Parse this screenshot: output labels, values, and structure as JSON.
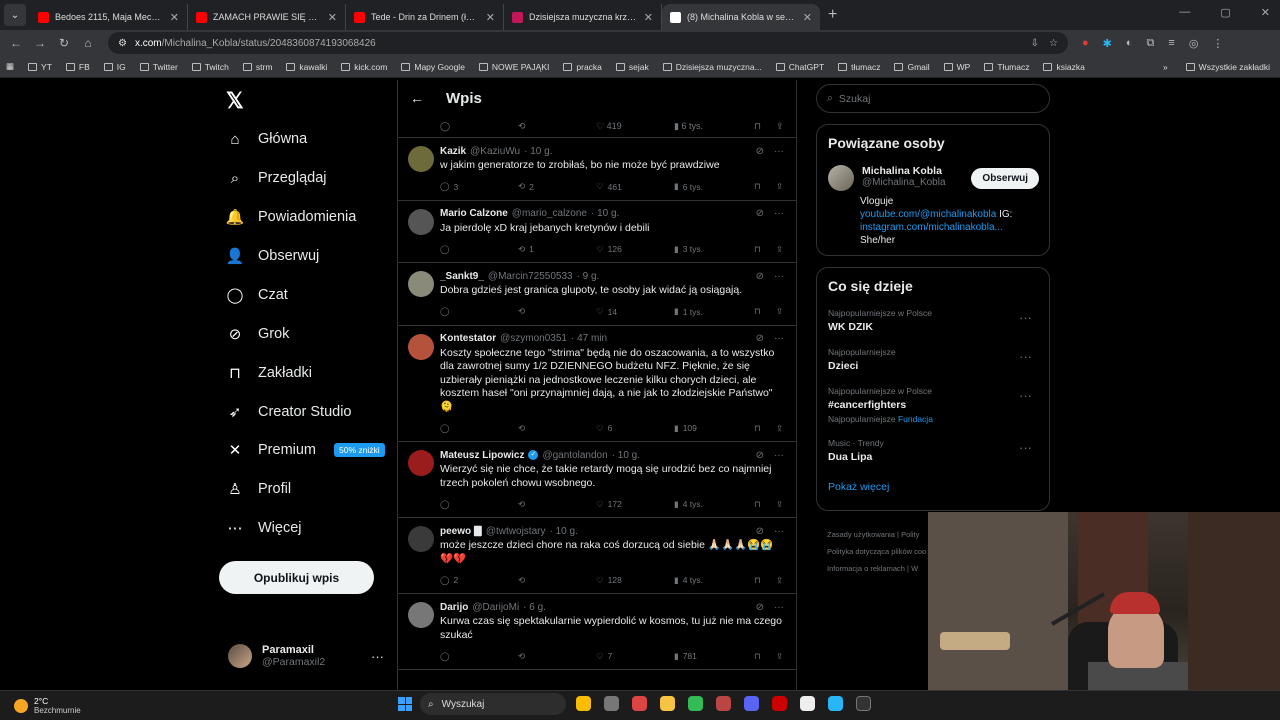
{
  "browser": {
    "tabs": [
      {
        "title": "Bedoes 2115, Maja Mecan, Cam",
        "color": "#ff0000"
      },
      {
        "title": "ZAMACH PRAWIE SIĘ UDAŁ - Yo",
        "color": "#ff0000"
      },
      {
        "title": "Tede - Drin za Drinem (łatwogo",
        "color": "#ff0000"
      },
      {
        "title": "Dzisiejsza muzyczna krzyżówka",
        "color": "#c2185b"
      },
      {
        "title": "(8) Michalina Kobla w serwisie",
        "color": "#ffffff",
        "active": true
      }
    ],
    "new_tab": "+",
    "url_host": "x.com",
    "url_path": "/Michalina_Kobla/status/2048360874193068426",
    "bookmarks": [
      "YT",
      "FB",
      "IG",
      "Twitter",
      "Twitch",
      "strm",
      "kawalki",
      "kick.com",
      "Mapy Google",
      "NOWE PAJĄKI",
      "pracka",
      "sejak",
      "Dzisiejsza muzyczna...",
      "ChatGPT",
      "tłumacz",
      "Gmail",
      "WP",
      "Tłumacz",
      "ksiazka"
    ],
    "bookmarks_more": "»",
    "all_bookmarks": "Wszystkie zakładki"
  },
  "nav": {
    "items": [
      {
        "label": "Główna",
        "icon": "home-icon",
        "glyph": "⌂"
      },
      {
        "label": "Przeglądaj",
        "icon": "search-icon",
        "glyph": "⌕"
      },
      {
        "label": "Powiadomienia",
        "icon": "bell-icon",
        "glyph": "🔔"
      },
      {
        "label": "Obserwuj",
        "icon": "follow-icon",
        "glyph": "👤"
      },
      {
        "label": "Czat",
        "icon": "chat-icon",
        "glyph": "◯"
      },
      {
        "label": "Grok",
        "icon": "grok-icon",
        "glyph": "⊘"
      },
      {
        "label": "Zakładki",
        "icon": "bookmark-icon",
        "glyph": "⊓"
      },
      {
        "label": "Creator Studio",
        "icon": "rocket-icon",
        "glyph": "➶"
      },
      {
        "label": "Premium",
        "icon": "x-icon",
        "glyph": "✕"
      },
      {
        "label": "Profil",
        "icon": "profile-icon",
        "glyph": "♙"
      },
      {
        "label": "Więcej",
        "icon": "more-icon",
        "glyph": "⋯"
      }
    ],
    "premium_badge": "50% zniżki",
    "post_button": "Opublikuj wpis",
    "account": {
      "name": "Paramaxil",
      "handle": "@Paramaxil2"
    }
  },
  "feed": {
    "title": "Wpis",
    "top_actions": {
      "likes": "419",
      "views": "6 tys."
    },
    "posts": [
      {
        "name": "Kazik",
        "handle": "@KaziuWu",
        "time": "· 10 g.",
        "text": "w jakim generatorze to zrobiłaś, bo nie może być prawdziwe",
        "replies": "3",
        "reposts": "2",
        "likes": "461",
        "views": "6 tys.",
        "avatar": "#6d6a3c"
      },
      {
        "name": "Mario Calzone",
        "handle": "@mario_calzone",
        "time": "· 10 g.",
        "text": "Ja pierdolę xD kraj jebanych kretynów i debili",
        "replies": "",
        "reposts": "1",
        "likes": "126",
        "views": "3 tys.",
        "avatar": "#555555"
      },
      {
        "name": "_Sankt9_",
        "handle": "@Marcin72550533",
        "time": "· 9 g.",
        "text": "Dobra gdzieś jest granica glupoty, te osoby jak widać ją osiągają.",
        "replies": "",
        "reposts": "",
        "likes": "14",
        "views": "1 tys.",
        "avatar": "#8a8a7a"
      },
      {
        "name": "Kontestator",
        "handle": "@szymon0351",
        "time": "· 47 min",
        "text": "Koszty społeczne tego \"strima\" będą nie do oszacowania, a to wszystko dla zawrotnej sumy 1/2 DZIENNEGO budżetu NFZ. Pięknie, że się uzbierały pieniążki na jednostkowe leczenie kilku chorych dzieci, ale kosztem haseł \"oni przynajmniej dają, a nie jak to złodziejskie Państwo\" 🫠",
        "replies": "",
        "reposts": "",
        "likes": "6",
        "views": "109",
        "avatar": "#b5523b"
      },
      {
        "name": "Mateusz Lipowicz",
        "handle": "@gantolandon",
        "time": "· 10 g.",
        "text": "Wierzyć się nie chce, że takie retardy mogą się urodzić bez co najmniej trzech pokoleń chowu wsobnego.",
        "replies": "",
        "reposts": "",
        "likes": "172",
        "views": "4 tys.",
        "avatar": "#9b1c1c",
        "verified": true
      },
      {
        "name": "peewo 🀫",
        "handle": "@twtwojstary",
        "time": "· 10 g.",
        "text": "może jeszcze dzieci chore na raka coś dorzucą od siebie 🙏🏻🙏🏻🙏🏻😭😭💔💔",
        "replies": "2",
        "reposts": "",
        "likes": "128",
        "views": "4 tys.",
        "avatar": "#3a3a3a"
      },
      {
        "name": "Darijo",
        "handle": "@DarijoMi",
        "time": "· 6 g.",
        "text": "Kurwa czas się spektakularnie wypierdolić w kosmos, tu już nie ma czego szukać",
        "replies": "",
        "reposts": "",
        "likes": "7",
        "views": "781",
        "avatar": "#777777"
      }
    ]
  },
  "right": {
    "search_placeholder": "Szukaj",
    "related_title": "Powiązane osoby",
    "related": {
      "name": "Michalina Kobla",
      "handle": "@Michalina_Kobla",
      "follow": "Obserwuj",
      "bio1": "Vloguje",
      "bio2": "youtube.com/@michalinakobla",
      "bio2b": "IG:",
      "bio3": "instagram.com/michalinakobla...",
      "bio4": "She/her"
    },
    "trends_title": "Co się dzieje",
    "trends": [
      {
        "context": "Najpopularniejsze w Polsce",
        "name": "WK DZIK"
      },
      {
        "context": "Najpopularniejsze",
        "name": "Dzieci"
      },
      {
        "context": "Najpopularniejsze w Polsce",
        "name": "#cancerfighters",
        "sub": "Najpopularniejsze",
        "sub_link": "Fundacja"
      },
      {
        "context": "Music · Trendy",
        "name": "Dua Lipa"
      }
    ],
    "show_more": "Pokaż więcej",
    "footer": [
      "Zasady użytkowania  |  Polity",
      "Polityka dotycząca plików coo",
      "Informacja o reklamach  |  W"
    ]
  },
  "taskbar": {
    "temp": "2°C",
    "weather": "Bezchmurnie",
    "search": "Wyszukaj"
  },
  "colors": {
    "accent": "#1d9bf0",
    "background": "#000000"
  }
}
